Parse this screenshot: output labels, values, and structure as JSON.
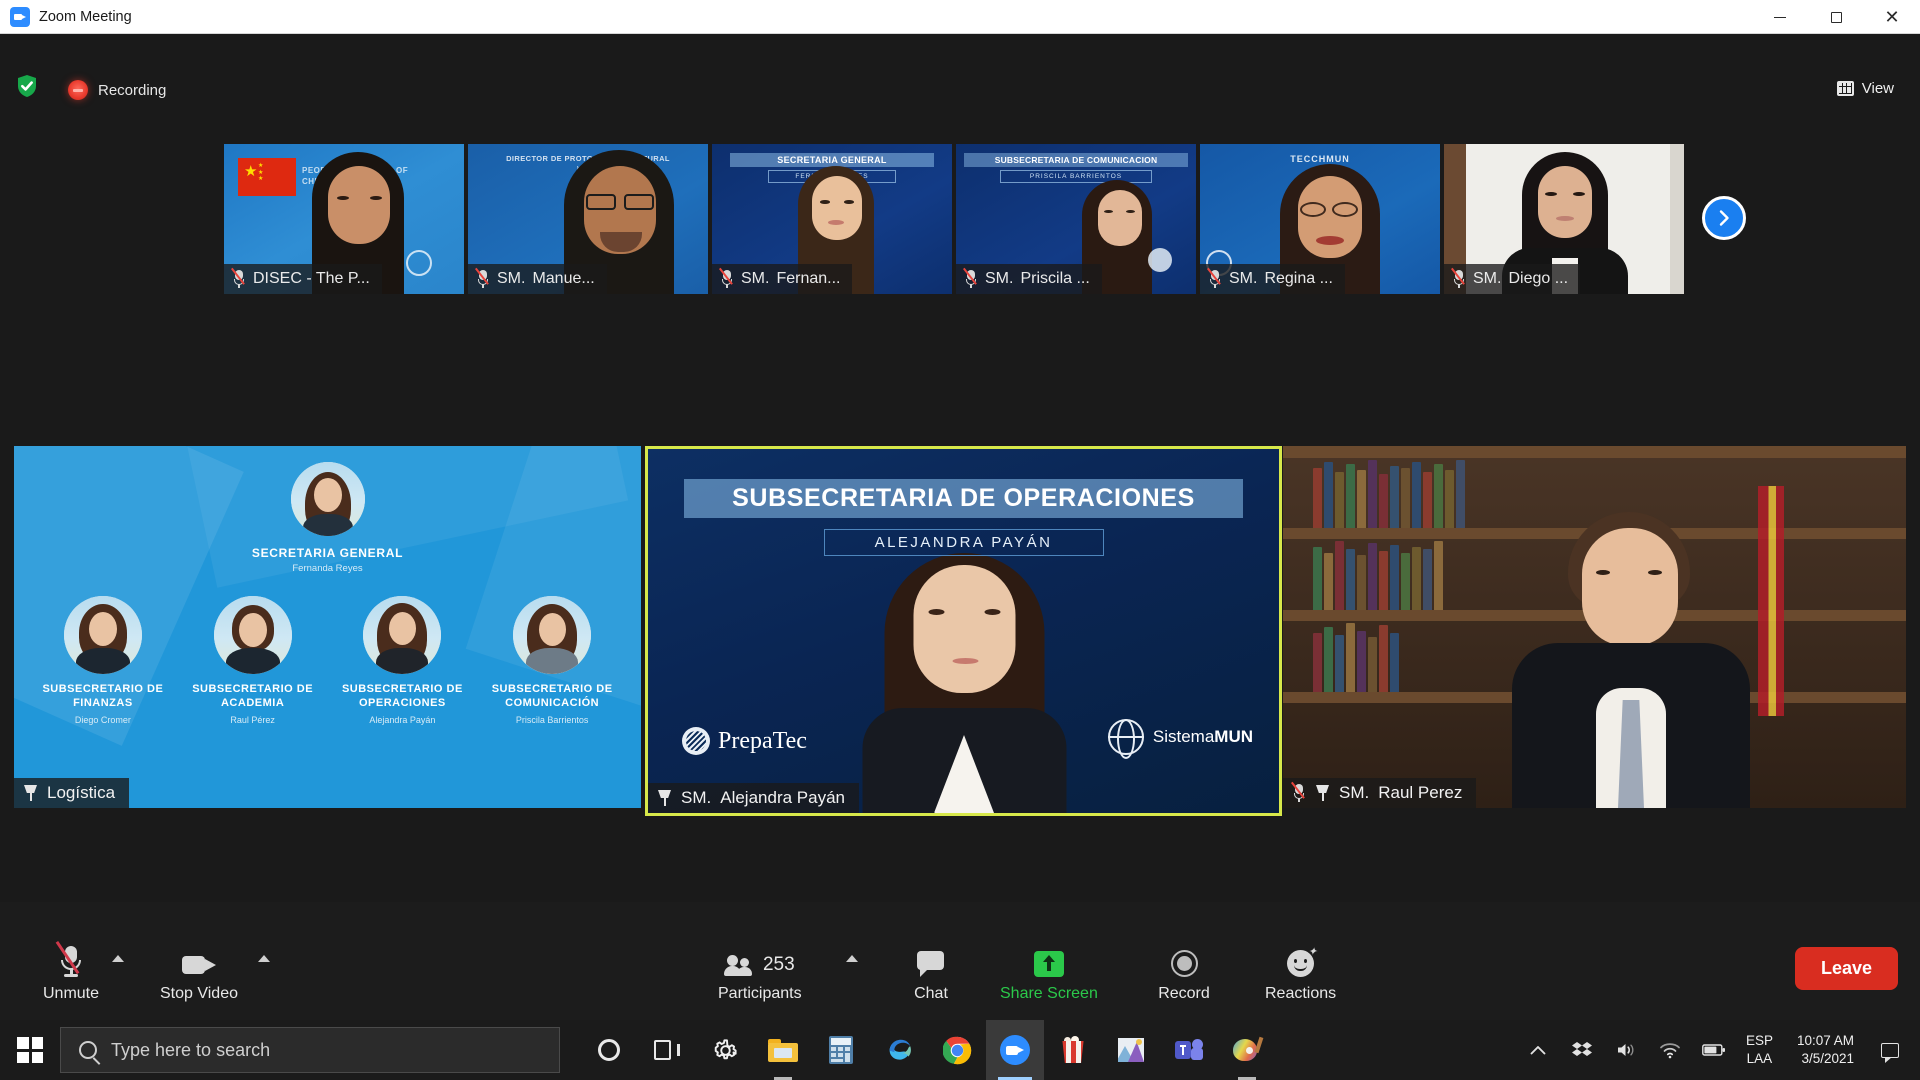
{
  "window": {
    "title": "Zoom Meeting",
    "app_icon": "zoom-icon",
    "minimize_label": "Minimize",
    "maximize_label": "Restore",
    "close_label": "Close"
  },
  "status_bar": {
    "encryption_icon": "shield-check-icon",
    "recording_icon": "record-dot-icon",
    "recording_label": "Recording",
    "view_icon": "grid-view-icon",
    "view_label": "View"
  },
  "thumbnails": [
    {
      "name": "DISEC - The P...",
      "prefix": "",
      "mic": "mic-muted-icon",
      "background": "china-flag-slide"
    },
    {
      "name": "Manue...",
      "prefix": "SM.",
      "mic": "mic-muted-icon",
      "background": "director-slide"
    },
    {
      "name": "Fernan...",
      "prefix": "SM.",
      "mic": "mic-muted-icon",
      "background": "secretaria-general-slide"
    },
    {
      "name": "Priscila ...",
      "prefix": "SM.",
      "mic": "mic-muted-icon",
      "background": "subsecretaria-comunicacion-slide"
    },
    {
      "name": "Regina ...",
      "prefix": "SM.",
      "mic": "mic-muted-icon",
      "background": "tecchmun-slide"
    },
    {
      "name": "Diego ...",
      "prefix": "SM.",
      "mic": "mic-muted-icon",
      "background": "plain-wall"
    }
  ],
  "thumbnail_slide_text": {
    "t1_line1": "PEOPLE'S REPUBLIC OF",
    "t1_line2": "CHINA",
    "t2_title": "DIRECTOR DE PROTOCOLO Y CULTURAL",
    "t2_name": "Manuel",
    "t3_title": "SECRETARIA GENERAL",
    "t3_name": "FERNANDA REYES",
    "t4_title": "SUBSECRETARIA DE COMUNICACION",
    "t4_name": "PRISCILA BARRIENTOS",
    "t5_title": "TECCHMUN"
  },
  "next_page": {
    "icon": "chevron-right-icon",
    "label": "Next page"
  },
  "tiles": {
    "logistica": {
      "name_badge": "Logística",
      "pin_icon": "pin-icon",
      "slide": {
        "head_role": "SECRETARIA GENERAL",
        "head_person": "Fernanda Reyes",
        "members": [
          {
            "role": "SUBSECRETARIO DE FINANZAS",
            "person": "Diego Cromer"
          },
          {
            "role": "SUBSECRETARIO DE ACADEMIA",
            "person": "Raul Pérez"
          },
          {
            "role": "SUBSECRETARIO DE OPERACIONES",
            "person": "Alejandra Payán"
          },
          {
            "role": "SUBSECRETARIO DE COMUNICACIÓN",
            "person": "Priscila Barrientos"
          }
        ]
      }
    },
    "speaker": {
      "prefix": "SM.",
      "name": "Alejandra Payán",
      "pin_icon": "pin-icon",
      "slide_title": "SUBSECRETARIA DE OPERACIONES",
      "slide_subtitle": "ALEJANDRA PAYÁN",
      "logo_left": "PrepaTec",
      "logo_right_a": "Sistema",
      "logo_right_b": "MUN",
      "active_speaker": true
    },
    "raul": {
      "prefix": "SM.",
      "name": "Raul Perez",
      "pin_icon": "pin-icon",
      "mic": "mic-muted-icon"
    }
  },
  "toolbar": {
    "unmute": {
      "label": "Unmute",
      "icon": "mic-muted-icon",
      "has_caret": true
    },
    "stop_video": {
      "label": "Stop Video",
      "icon": "camera-icon",
      "has_caret": true
    },
    "participants": {
      "label": "Participants",
      "icon": "people-icon",
      "count": "253",
      "has_caret": true
    },
    "chat": {
      "label": "Chat",
      "icon": "chat-bubble-icon"
    },
    "share_screen": {
      "label": "Share Screen",
      "icon": "share-screen-icon"
    },
    "record": {
      "label": "Record",
      "icon": "record-icon"
    },
    "reactions": {
      "label": "Reactions",
      "icon": "reactions-icon"
    },
    "leave": {
      "label": "Leave"
    }
  },
  "taskbar": {
    "start_label": "Start",
    "search_placeholder": "Type here to search",
    "apps": [
      {
        "name": "cortana-icon"
      },
      {
        "name": "task-view-icon"
      },
      {
        "name": "settings-gear-icon"
      },
      {
        "name": "file-explorer-icon"
      },
      {
        "name": "calculator-icon"
      },
      {
        "name": "microsoft-edge-icon"
      },
      {
        "name": "google-chrome-icon"
      },
      {
        "name": "zoom-icon"
      },
      {
        "name": "popcorn-icon"
      },
      {
        "name": "photos-icon"
      },
      {
        "name": "microsoft-teams-icon"
      },
      {
        "name": "paint-icon"
      }
    ],
    "tray": {
      "show_hidden_icon": "chevron-up-icon",
      "dropbox_icon": "dropbox-icon",
      "volume_icon": "speaker-muted-icon",
      "network_icon": "wifi-icon",
      "battery_icon": "battery-icon",
      "language_line1": "ESP",
      "language_line2": "LAA",
      "time": "10:07 AM",
      "date": "3/5/2021",
      "action_center_icon": "notification-icon"
    }
  },
  "colors": {
    "zoom_blue": "#2d8cff",
    "accent_green": "#2bc84a",
    "leave_red": "#d92d20",
    "active_speaker_border": "#d7e84a",
    "slide_blue": "#2197d9",
    "dark_slide_blue": "#0b2b58"
  }
}
